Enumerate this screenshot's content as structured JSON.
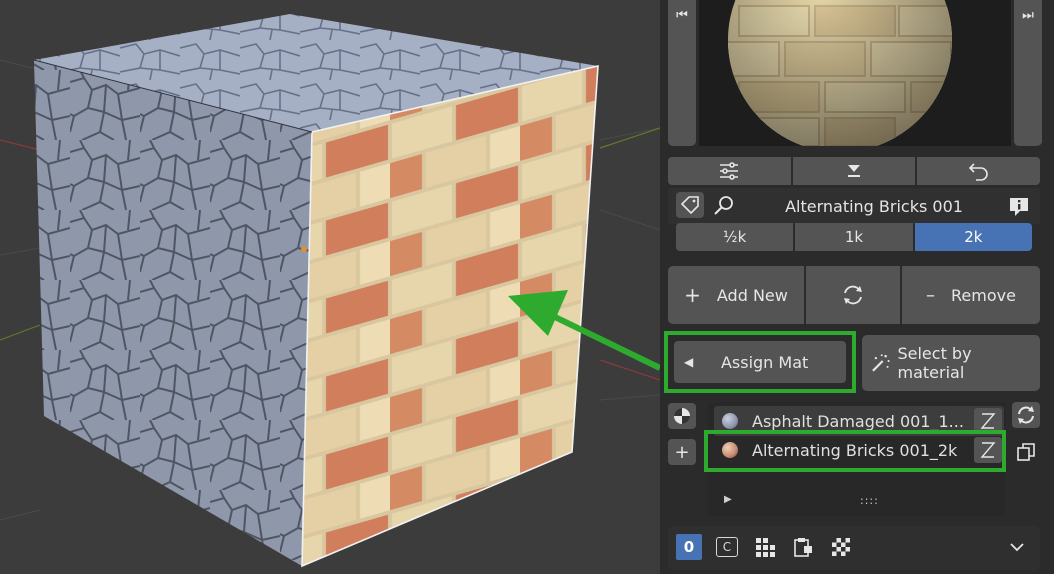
{
  "preview": {
    "nav_prev_icon": "skip-start-icon",
    "nav_next_icon": "skip-end-icon",
    "nav_prev_glyph": "⏮",
    "nav_next_glyph": "⏭"
  },
  "toolbar_icons": [
    "sliders-icon",
    "download-icon",
    "undo-icon"
  ],
  "asset": {
    "name": "Alternating Bricks 001",
    "resolutions": [
      "½k",
      "1k",
      "2k"
    ],
    "active_resolution": "2k"
  },
  "actions": {
    "add_new_label": "Add New",
    "remove_label": "Remove",
    "add_symbol": "+",
    "remove_symbol": "–"
  },
  "assign": {
    "label": "Assign Mat",
    "select_by_material_label": "Select by material"
  },
  "materials": {
    "items": [
      {
        "name": "Asphalt Damaged 001_1...",
        "color": "#8d97ad"
      },
      {
        "name": "Alternating Bricks 001_2k",
        "color": "#c48a72"
      }
    ],
    "selected_index": 1,
    "add_symbol": "+",
    "footer_grip": "::::"
  },
  "bottom_bar": {
    "count_label": "0",
    "c_label": "C"
  },
  "colors": {
    "accent_blue": "#4772b3",
    "highlight_green": "#2eab2e",
    "panel_bg": "#2b2b2b",
    "button_bg": "#545454"
  }
}
